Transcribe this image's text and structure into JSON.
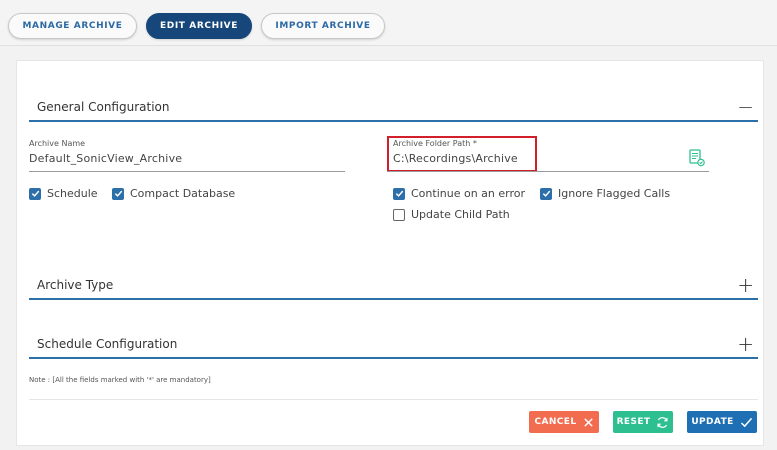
{
  "tabs": [
    {
      "label": "MANAGE ARCHIVE",
      "active": false
    },
    {
      "label": "EDIT ARCHIVE",
      "active": true
    },
    {
      "label": "IMPORT ARCHIVE",
      "active": false
    }
  ],
  "sections": {
    "general": {
      "title": "General Configuration",
      "toggle": "−"
    },
    "archive_type": {
      "title": "Archive Type",
      "toggle": "+"
    },
    "schedule_config": {
      "title": "Schedule Configuration",
      "toggle": "+"
    }
  },
  "fields": {
    "archive_name": {
      "label": "Archive Name",
      "value": "Default_SonicView_Archive"
    },
    "archive_folder_path": {
      "label": "Archive Folder Path *",
      "value": "C:\\Recordings\\Archive"
    }
  },
  "checkboxes": {
    "schedule": {
      "label": "Schedule",
      "checked": true
    },
    "compact_database": {
      "label": "Compact Database",
      "checked": true
    },
    "continue_on_error": {
      "label": "Continue on an error",
      "checked": true
    },
    "ignore_flagged_calls": {
      "label": "Ignore Flagged Calls",
      "checked": true
    },
    "update_child_path": {
      "label": "Update Child Path",
      "checked": false
    }
  },
  "note": "Note : [All the fields marked with '*' are mandatory]",
  "buttons": {
    "cancel": "CANCEL",
    "reset": "RESET",
    "update": "UPDATE"
  },
  "colors": {
    "primary": "#17467a",
    "accent_line": "#2d6fa8",
    "cancel": "#f26c4f",
    "reset": "#2dbf8f",
    "update": "#1e6fb3",
    "highlight": "#d21f2a"
  }
}
